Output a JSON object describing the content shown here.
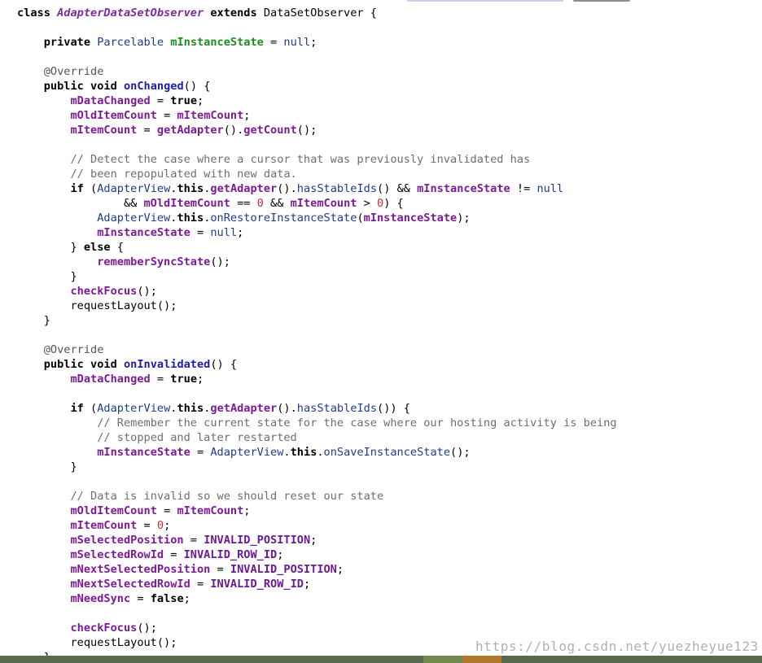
{
  "code_lines": [
    [
      [
        "kw",
        "class"
      ],
      [
        "pl",
        " "
      ],
      [
        "cls",
        "AdapterDataSetObserver"
      ],
      [
        "pl",
        " "
      ],
      [
        "kw",
        "extends"
      ],
      [
        "pl",
        " DataSetObserver {"
      ]
    ],
    [],
    [
      [
        "pl",
        "    "
      ],
      [
        "kw",
        "private"
      ],
      [
        "pl",
        " "
      ],
      [
        "type",
        "Parcelable"
      ],
      [
        "pl",
        " "
      ],
      [
        "fldg",
        "mInstanceState"
      ],
      [
        "pl",
        " = "
      ],
      [
        "type",
        "null"
      ],
      [
        "pl",
        ";"
      ]
    ],
    [],
    [
      [
        "pl",
        "    "
      ],
      [
        "ann",
        "@Override"
      ]
    ],
    [
      [
        "pl",
        "    "
      ],
      [
        "kw",
        "public void"
      ],
      [
        "pl",
        " "
      ],
      [
        "mth",
        "onChanged"
      ],
      [
        "pl",
        "() {"
      ]
    ],
    [
      [
        "pl",
        "        "
      ],
      [
        "fld",
        "mDataChanged"
      ],
      [
        "pl",
        " = "
      ],
      [
        "kw",
        "true"
      ],
      [
        "pl",
        ";"
      ]
    ],
    [
      [
        "pl",
        "        "
      ],
      [
        "fld",
        "mOldItemCount"
      ],
      [
        "pl",
        " = "
      ],
      [
        "fld",
        "mItemCount"
      ],
      [
        "pl",
        ";"
      ]
    ],
    [
      [
        "pl",
        "        "
      ],
      [
        "fld",
        "mItemCount"
      ],
      [
        "pl",
        " = "
      ],
      [
        "call",
        "getAdapter"
      ],
      [
        "pl",
        "()."
      ],
      [
        "call",
        "getCount"
      ],
      [
        "pl",
        "();"
      ]
    ],
    [],
    [
      [
        "pl",
        "        "
      ],
      [
        "cmt",
        "// Detect the case where a cursor that was previously invalidated has"
      ]
    ],
    [
      [
        "pl",
        "        "
      ],
      [
        "cmt",
        "// been repopulated with new data."
      ]
    ],
    [
      [
        "pl",
        "        "
      ],
      [
        "kw",
        "if"
      ],
      [
        "pl",
        " ("
      ],
      [
        "ext",
        "AdapterView"
      ],
      [
        "pl",
        "."
      ],
      [
        "kw",
        "this"
      ],
      [
        "pl",
        "."
      ],
      [
        "call",
        "getAdapter"
      ],
      [
        "pl",
        "()."
      ],
      [
        "ext",
        "hasStableIds"
      ],
      [
        "pl",
        "() && "
      ],
      [
        "fld",
        "mInstanceState"
      ],
      [
        "pl",
        " != "
      ],
      [
        "type",
        "null"
      ]
    ],
    [
      [
        "pl",
        "                && "
      ],
      [
        "fld",
        "mOldItemCount"
      ],
      [
        "pl",
        " == "
      ],
      [
        "num",
        "0"
      ],
      [
        "pl",
        " && "
      ],
      [
        "fld",
        "mItemCount"
      ],
      [
        "pl",
        " > "
      ],
      [
        "num",
        "0"
      ],
      [
        "pl",
        ") {"
      ]
    ],
    [
      [
        "pl",
        "            "
      ],
      [
        "ext",
        "AdapterView"
      ],
      [
        "pl",
        "."
      ],
      [
        "kw",
        "this"
      ],
      [
        "pl",
        "."
      ],
      [
        "ext",
        "onRestoreInstanceState"
      ],
      [
        "pl",
        "("
      ],
      [
        "fld",
        "mInstanceState"
      ],
      [
        "pl",
        ");"
      ]
    ],
    [
      [
        "pl",
        "            "
      ],
      [
        "fld",
        "mInstanceState"
      ],
      [
        "pl",
        " = "
      ],
      [
        "type",
        "null"
      ],
      [
        "pl",
        ";"
      ]
    ],
    [
      [
        "pl",
        "        } "
      ],
      [
        "kw",
        "else"
      ],
      [
        "pl",
        " {"
      ]
    ],
    [
      [
        "pl",
        "            "
      ],
      [
        "call",
        "rememberSyncState"
      ],
      [
        "pl",
        "();"
      ]
    ],
    [
      [
        "pl",
        "        }"
      ]
    ],
    [
      [
        "pl",
        "        "
      ],
      [
        "call",
        "checkFocus"
      ],
      [
        "pl",
        "();"
      ]
    ],
    [
      [
        "pl",
        "        requestLayout();"
      ]
    ],
    [
      [
        "pl",
        "    }"
      ]
    ],
    [],
    [
      [
        "pl",
        "    "
      ],
      [
        "ann",
        "@Override"
      ]
    ],
    [
      [
        "pl",
        "    "
      ],
      [
        "kw",
        "public void"
      ],
      [
        "pl",
        " "
      ],
      [
        "mth",
        "onInvalidated"
      ],
      [
        "pl",
        "() {"
      ]
    ],
    [
      [
        "pl",
        "        "
      ],
      [
        "fld",
        "mDataChanged"
      ],
      [
        "pl",
        " = "
      ],
      [
        "kw",
        "true"
      ],
      [
        "pl",
        ";"
      ]
    ],
    [],
    [
      [
        "pl",
        "        "
      ],
      [
        "kw",
        "if"
      ],
      [
        "pl",
        " ("
      ],
      [
        "ext",
        "AdapterView"
      ],
      [
        "pl",
        "."
      ],
      [
        "kw",
        "this"
      ],
      [
        "pl",
        "."
      ],
      [
        "call",
        "getAdapter"
      ],
      [
        "pl",
        "()."
      ],
      [
        "ext",
        "hasStableIds"
      ],
      [
        "pl",
        "()) {"
      ]
    ],
    [
      [
        "pl",
        "            "
      ],
      [
        "cmt",
        "// Remember the current state for the case where our hosting activity is being"
      ]
    ],
    [
      [
        "pl",
        "            "
      ],
      [
        "cmt",
        "// stopped and later restarted"
      ]
    ],
    [
      [
        "pl",
        "            "
      ],
      [
        "fld",
        "mInstanceState"
      ],
      [
        "pl",
        " = "
      ],
      [
        "ext",
        "AdapterView"
      ],
      [
        "pl",
        "."
      ],
      [
        "kw",
        "this"
      ],
      [
        "pl",
        "."
      ],
      [
        "ext",
        "onSaveInstanceState"
      ],
      [
        "pl",
        "();"
      ]
    ],
    [
      [
        "pl",
        "        }"
      ]
    ],
    [],
    [
      [
        "pl",
        "        "
      ],
      [
        "cmt",
        "// Data is invalid so we should reset our state"
      ]
    ],
    [
      [
        "pl",
        "        "
      ],
      [
        "fld",
        "mOldItemCount"
      ],
      [
        "pl",
        " = "
      ],
      [
        "fld",
        "mItemCount"
      ],
      [
        "pl",
        ";"
      ]
    ],
    [
      [
        "pl",
        "        "
      ],
      [
        "fld",
        "mItemCount"
      ],
      [
        "pl",
        " = "
      ],
      [
        "num",
        "0"
      ],
      [
        "pl",
        ";"
      ]
    ],
    [
      [
        "pl",
        "        "
      ],
      [
        "fld",
        "mSelectedPosition"
      ],
      [
        "pl",
        " = "
      ],
      [
        "const",
        "INVALID_POSITION"
      ],
      [
        "pl",
        ";"
      ]
    ],
    [
      [
        "pl",
        "        "
      ],
      [
        "fld",
        "mSelectedRowId"
      ],
      [
        "pl",
        " = "
      ],
      [
        "const",
        "INVALID_ROW_ID"
      ],
      [
        "pl",
        ";"
      ]
    ],
    [
      [
        "pl",
        "        "
      ],
      [
        "fld",
        "mNextSelectedPosition"
      ],
      [
        "pl",
        " = "
      ],
      [
        "const",
        "INVALID_POSITION"
      ],
      [
        "pl",
        ";"
      ]
    ],
    [
      [
        "pl",
        "        "
      ],
      [
        "fld",
        "mNextSelectedRowId"
      ],
      [
        "pl",
        " = "
      ],
      [
        "const",
        "INVALID_ROW_ID"
      ],
      [
        "pl",
        ";"
      ]
    ],
    [
      [
        "pl",
        "        "
      ],
      [
        "fld",
        "mNeedSync"
      ],
      [
        "pl",
        " = "
      ],
      [
        "kw",
        "false"
      ],
      [
        "pl",
        ";"
      ]
    ],
    [],
    [
      [
        "pl",
        "        "
      ],
      [
        "call",
        "checkFocus"
      ],
      [
        "pl",
        "();"
      ]
    ],
    [
      [
        "pl",
        "        requestLayout();"
      ]
    ],
    [
      [
        "pl",
        "    }"
      ]
    ]
  ],
  "watermark": {
    "text": "https://blog.csdn.net/yuezheyue123"
  },
  "colors": {
    "background": "#ffffff",
    "keyword": "#000000",
    "field": "#7d1a96",
    "method_decl": "#1c1ca8",
    "comment": "#6e6e6e",
    "number": "#c0303c",
    "type": "#1f3b8c",
    "status_bar": "#55664a"
  }
}
